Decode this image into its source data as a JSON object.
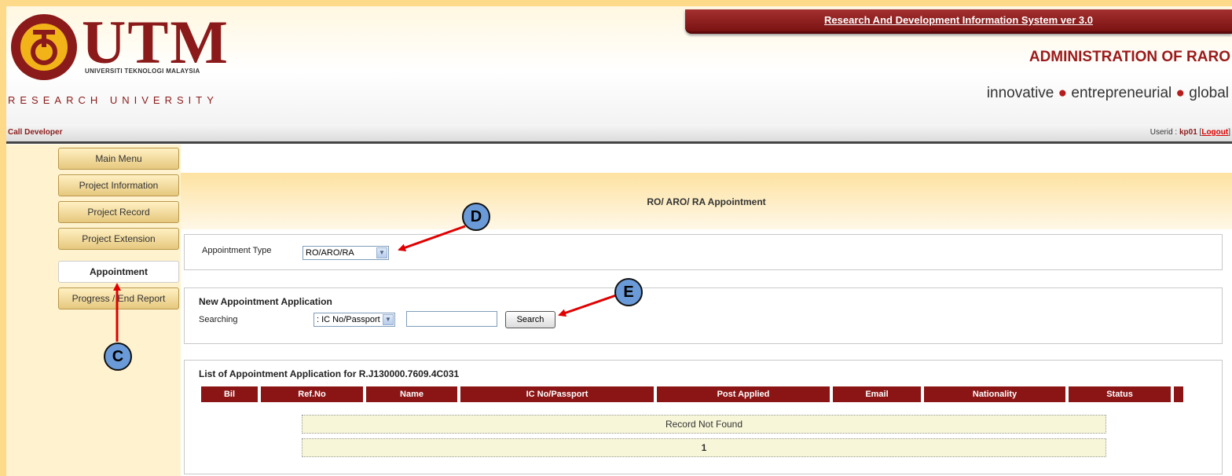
{
  "header": {
    "logo_text": "UTM",
    "logo_subtitle": "UNIVERSITI TEKNOLOGI MALAYSIA",
    "research_label": "RESEARCH UNIVERSITY",
    "system_title": "Research And Development Information System ver 3.0",
    "admin_title": "ADMINISTRATION OF RARO",
    "tagline": [
      "innovative",
      "entrepreneurial",
      "global"
    ]
  },
  "userbar": {
    "call_developer": "Call Developer",
    "userid_label": "Userid : ",
    "userid": "kp01",
    "logout": "Logout"
  },
  "sidebar": {
    "items": [
      {
        "label": "Main Menu",
        "active": false
      },
      {
        "label": "Project Information",
        "active": false
      },
      {
        "label": "Project Record",
        "active": false
      },
      {
        "label": "Project Extension",
        "active": false
      },
      {
        "label": "Appointment",
        "active": true
      },
      {
        "label": "Progress / End Report",
        "active": false
      }
    ]
  },
  "main": {
    "page_title": "RO/ ARO/ RA Appointment",
    "appointment_type": {
      "label": "Appointment Type",
      "value": "RO/ARO/RA"
    },
    "new_application": {
      "title": "New Appointment Application",
      "search_label": "Searching",
      "search_by": ": IC No/Passport",
      "search_value": "",
      "search_button": "Search"
    },
    "list": {
      "title": "List of Appointment Application for R.J130000.7609.4C031",
      "columns": [
        "Bil",
        "Ref.No",
        "Name",
        "IC No/Passport",
        "Post Applied",
        "Email",
        "Nationality",
        "Status",
        ""
      ],
      "empty_message": "Record Not Found",
      "page": "1"
    }
  },
  "annotations": {
    "c": "C",
    "d": "D",
    "e": "E"
  },
  "colors": {
    "accent": "#8b1515",
    "page_bg": "#fdd98a",
    "callout": "#6a9bd8",
    "arrow": "#e00000"
  }
}
